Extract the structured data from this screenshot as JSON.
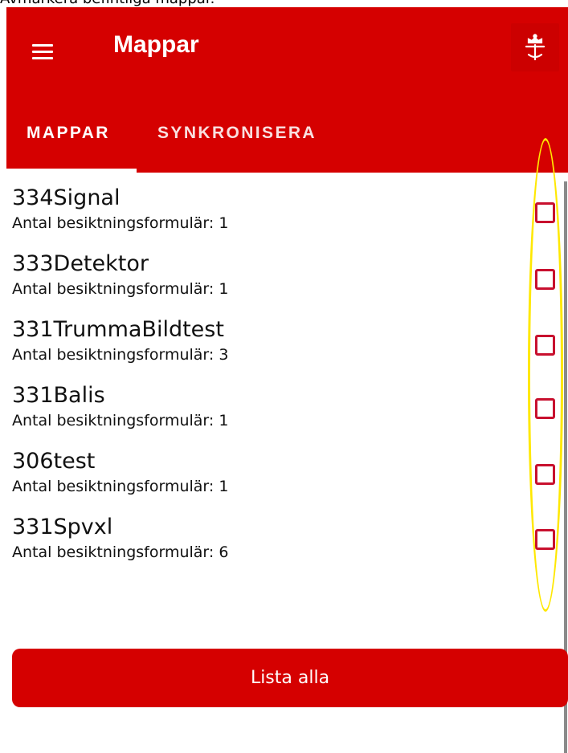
{
  "caption": "Avmarkera befintliga mappar.",
  "header": {
    "title": "Mappar",
    "menu_icon": "hamburger-menu-icon",
    "logo_icon": "trafikverket-crown-logo-icon"
  },
  "tabs": [
    {
      "label": "MAPPAR",
      "active": true
    },
    {
      "label": "SYNKRONISERA",
      "active": false
    }
  ],
  "folders": [
    {
      "name": "334Signal",
      "count": "Antal besiktningsformulär: 1",
      "checked": false
    },
    {
      "name": "333Detektor",
      "count": "Antal besiktningsformulär: 1",
      "checked": false
    },
    {
      "name": "331TrummaBildtest",
      "count": "Antal besiktningsformulär: 3",
      "checked": false
    },
    {
      "name": "331Balis",
      "count": "Antal besiktningsformulär: 1",
      "checked": false
    },
    {
      "name": "306test",
      "count": "Antal besiktningsformulär: 1",
      "checked": false
    },
    {
      "name": "331Spvxl",
      "count": "Antal besiktningsformulär: 6",
      "checked": false
    }
  ],
  "actions": {
    "list_all_label": "Lista alla"
  },
  "colors": {
    "primary": "#d50000",
    "checkbox_border": "#c8102e",
    "highlight": "#ffe800"
  }
}
